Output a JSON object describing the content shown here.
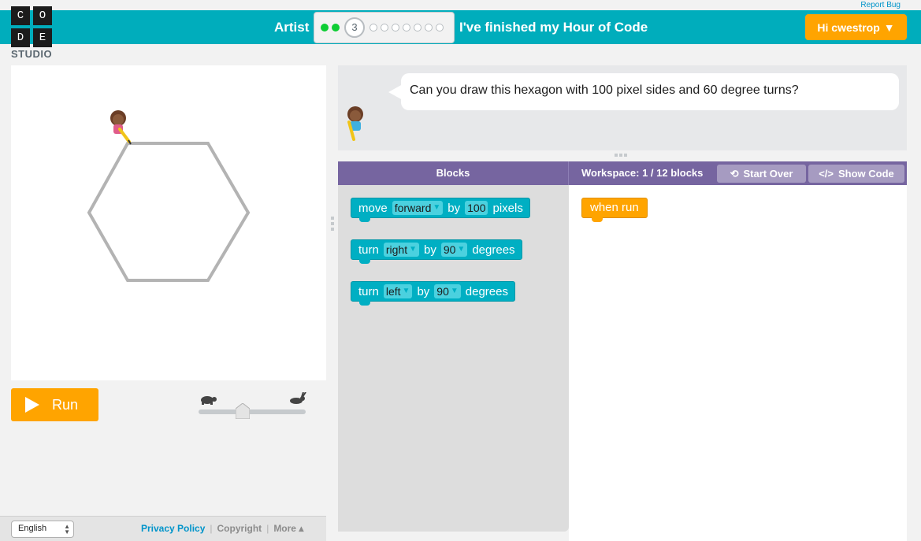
{
  "header": {
    "report_bug": "Report Bug",
    "logo_letters": [
      "C",
      "O",
      "D",
      "E"
    ],
    "logo_text": "STUDIO",
    "puzzle_name": "Artist",
    "current_level": "3",
    "finished_label": "I've finished my Hour of Code",
    "user_button": "Hi cwestrop",
    "progress": {
      "completed": 2,
      "current": 3,
      "remaining_after_current": 7
    }
  },
  "instructions": {
    "text": "Can you draw this hexagon with 100 pixel sides and 60 degree turns?"
  },
  "run_button": {
    "label": "Run"
  },
  "speed_slider": {
    "value": 0.4
  },
  "blocks_header": {
    "toolbox_title": "Blocks",
    "workspace_title": "Workspace: 1 / 12 blocks",
    "start_over": "Start Over",
    "show_code": "Show Code"
  },
  "toolbox_blocks": [
    {
      "word1": "move",
      "dropdown": "forward",
      "word2": "by",
      "value": "100",
      "unit": "pixels"
    },
    {
      "word1": "turn",
      "dropdown": "right",
      "word2": "by",
      "value": "90",
      "unit": "degrees"
    },
    {
      "word1": "turn",
      "dropdown": "left",
      "word2": "by",
      "value": "90",
      "unit": "degrees"
    }
  ],
  "workspace_blocks": [
    {
      "label": "when run"
    }
  ],
  "footer": {
    "language": "English",
    "privacy": "Privacy Policy",
    "copyright": "Copyright",
    "more": "More ▴"
  },
  "colors": {
    "topbar": "#00adbc",
    "orange": "#ffa400",
    "purple": "#7665a0",
    "block_teal": "#00afc3",
    "done_green": "#0ecd34"
  }
}
